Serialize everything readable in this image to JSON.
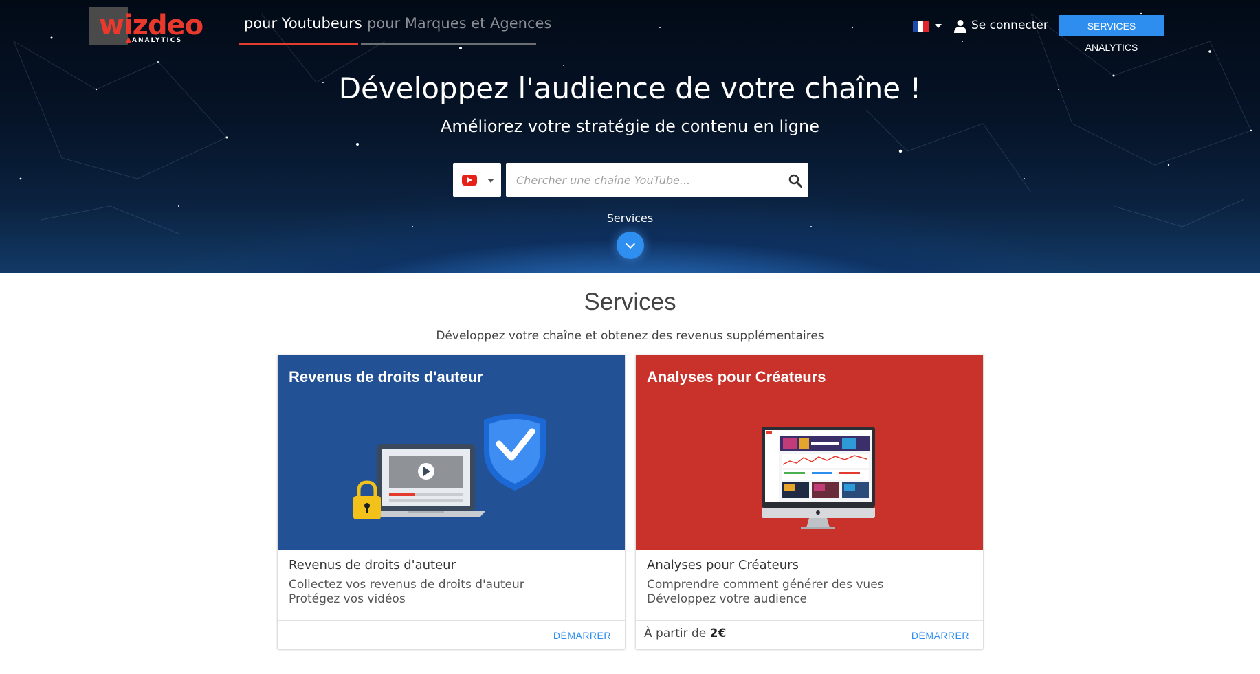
{
  "brand": {
    "logo_text": "wizdeo",
    "logo_sub": "ANALYTICS"
  },
  "nav": {
    "tabs": [
      {
        "label": "pour Youtubeurs",
        "active": true
      },
      {
        "label": "pour Marques et Agences",
        "active": false
      }
    ],
    "language_flag": "fr-flag-icon",
    "login_label": "Se connecter",
    "services_button": "SERVICES ANALYTICS"
  },
  "hero": {
    "title": "Développez l'audience de votre chaîne !",
    "subtitle": "Améliorez votre stratégie de contenu en ligne",
    "platform_icon": "youtube-icon",
    "search_placeholder": "Chercher une chaîne YouTube...",
    "services_label": "Services"
  },
  "services": {
    "title": "Services",
    "subtitle": "Développez votre chaîne et obtenez des revenus supplémentaires",
    "cards": [
      {
        "media_title": "Revenus de droits d'auteur",
        "title": "Revenus de droits d'auteur",
        "line1": "Collectez vos revenus de droits d'auteur",
        "line2": "Protégez vos vidéos",
        "action": "DÉMARRER",
        "image": "laptop-shield-lock-illustration"
      },
      {
        "media_title": "Analyses pour Créateurs",
        "title": "Analyses pour Créateurs",
        "line1": "Comprendre comment générer des vues",
        "line2": "Développez votre audience",
        "price_prefix": "À partir de",
        "price_value": "2€",
        "action": "DÉMARRER",
        "image": "monitor-dashboard-illustration"
      }
    ]
  },
  "colors": {
    "accent": "#2d8ef0",
    "brand_red": "#e33b2e",
    "card_blue": "#225295",
    "card_red": "#c8322a"
  }
}
